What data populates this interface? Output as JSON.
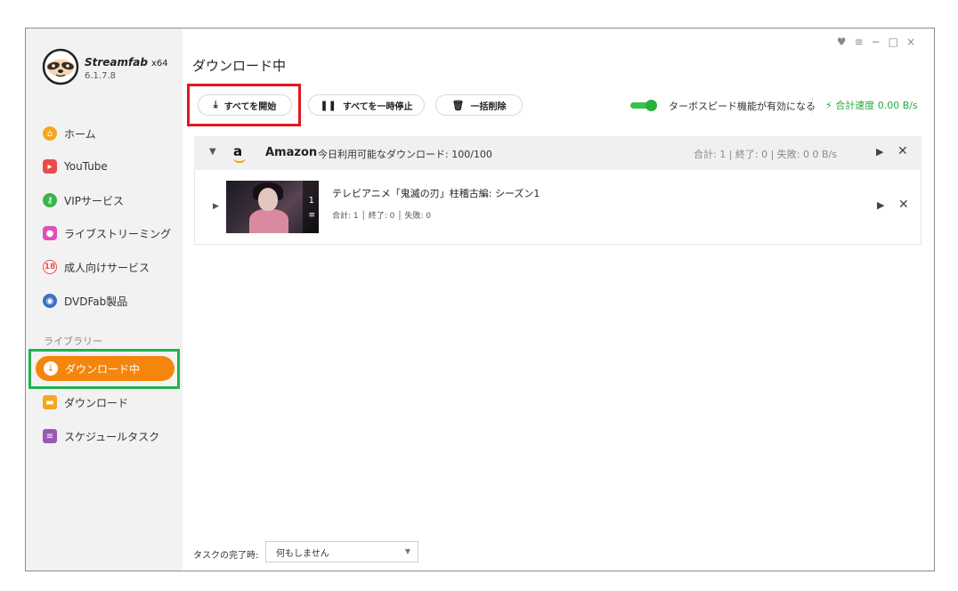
{
  "app": {
    "name": "Streamfab",
    "arch": "x64",
    "version": "6.1.7.8"
  },
  "window_controls": [
    "♥",
    "≡",
    "−",
    "□",
    "×"
  ],
  "sidebar": {
    "items": [
      {
        "label": "ホーム",
        "icon": "home-icon",
        "color": "#f5a623"
      },
      {
        "label": "YouTube",
        "icon": "youtube-icon",
        "color": "#e94b4b"
      },
      {
        "label": "VIPサービス",
        "icon": "key-icon",
        "color": "#39b54a"
      },
      {
        "label": "ライブストリーミング",
        "icon": "live-camera-icon",
        "color": "#e04fb4"
      },
      {
        "label": "成人向けサービス",
        "icon": "adult-18-icon",
        "color": "#e94b4b"
      },
      {
        "label": "DVDFab製品",
        "icon": "dvdfab-icon",
        "color": "#3a6fc4"
      }
    ],
    "library_heading": "ライブラリー",
    "library_items": [
      {
        "label": "ダウンロード中",
        "icon": "download-arrow-icon",
        "active": true
      },
      {
        "label": "ダウンロード",
        "icon": "folder-icon",
        "color": "#f5a623"
      },
      {
        "label": "スケジュールタスク",
        "icon": "schedule-list-icon",
        "color": "#9b59b6"
      }
    ]
  },
  "main": {
    "title": "ダウンロード中",
    "toolbar": {
      "start_all": "すべてを開始",
      "pause_all": "すべてを一時停止",
      "delete_all": "一括削除",
      "turbo_label": "ターボスピード機能が有効になる",
      "turbo_enabled": true,
      "total_speed": "合計速度 0.00 B/s"
    },
    "group": {
      "icon_letter": "a",
      "name": "Amazon",
      "quota": "今日利用可能なダウンロード: 100/100",
      "stats": "合計: 1 | 終了: 0 | 失敗: 0   0 B/s"
    },
    "item": {
      "title": "テレビアニメ「鬼滅の刃」柱稽古編: シーズン1",
      "count": "1",
      "stats": "合計: 1 │ 終了: 0 │ 失敗: 0"
    },
    "footer": {
      "label": "タスクの完了時:",
      "selected": "何もしません"
    }
  }
}
